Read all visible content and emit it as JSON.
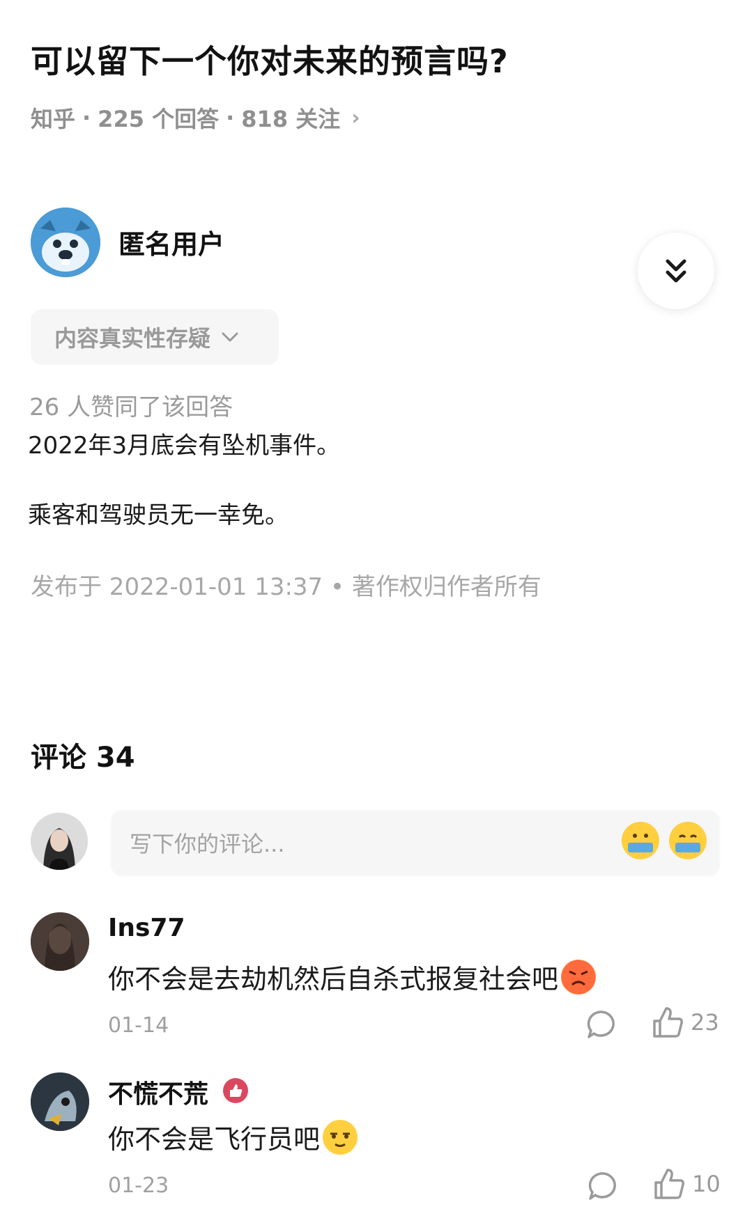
{
  "question": {
    "title": "可以留下一个你对未来的预言吗?",
    "source": "知乎",
    "answers": "225 个回答",
    "follows": "818 关注"
  },
  "answer": {
    "author": "匿名用户",
    "tag": "内容真实性存疑",
    "likes": "26 人赞同了该回答",
    "paragraphs": [
      "2022年3月底会有坠机事件。",
      "乘客和驾驶员无一幸免。"
    ],
    "published": "发布于 2022-01-01 13:37 • 著作权归作者所有"
  },
  "comments": {
    "header": "评论 34",
    "input_placeholder": "写下你的评论...",
    "items": [
      {
        "name": "Ins77",
        "text": "你不会是去劫机然后自杀式报复社会吧",
        "date": "01-14",
        "likes": "23"
      },
      {
        "name": "不慌不荒",
        "text": "你不会是飞行员吧",
        "date": "01-23",
        "likes": "10"
      }
    ]
  },
  "colors": {
    "accent_blue": "#4a9bd6",
    "badge_red": "#d9485f",
    "emoji_yellow": "#ffcf3f"
  }
}
